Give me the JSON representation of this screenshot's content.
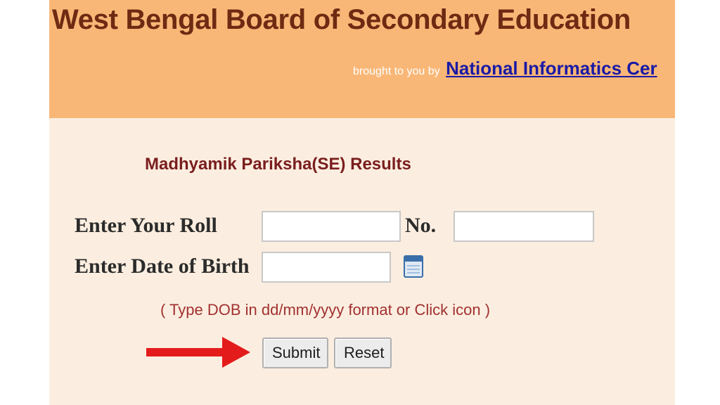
{
  "header": {
    "title": "West Bengal Board of Secondary Education",
    "byline_prefix": "brought to you by",
    "link_text": "National Informatics Cer",
    "background_color": "#f9b777",
    "title_color": "#6e2a12"
  },
  "form": {
    "heading": "Madhyamik Pariksha(SE) Results",
    "roll_label": "Enter Your Roll",
    "no_label": "No.",
    "roll_value": "",
    "no_value": "",
    "dob_label": "Enter Date of Birth",
    "dob_value": "",
    "dob_hint": "( Type DOB in dd/mm/yyyy format or Click icon  )",
    "submit_label": "Submit",
    "reset_label": "Reset",
    "calendar_icon": "calendar-icon",
    "arrow_icon": "red-arrow-icon",
    "arrow_color": "#e41b1b"
  }
}
